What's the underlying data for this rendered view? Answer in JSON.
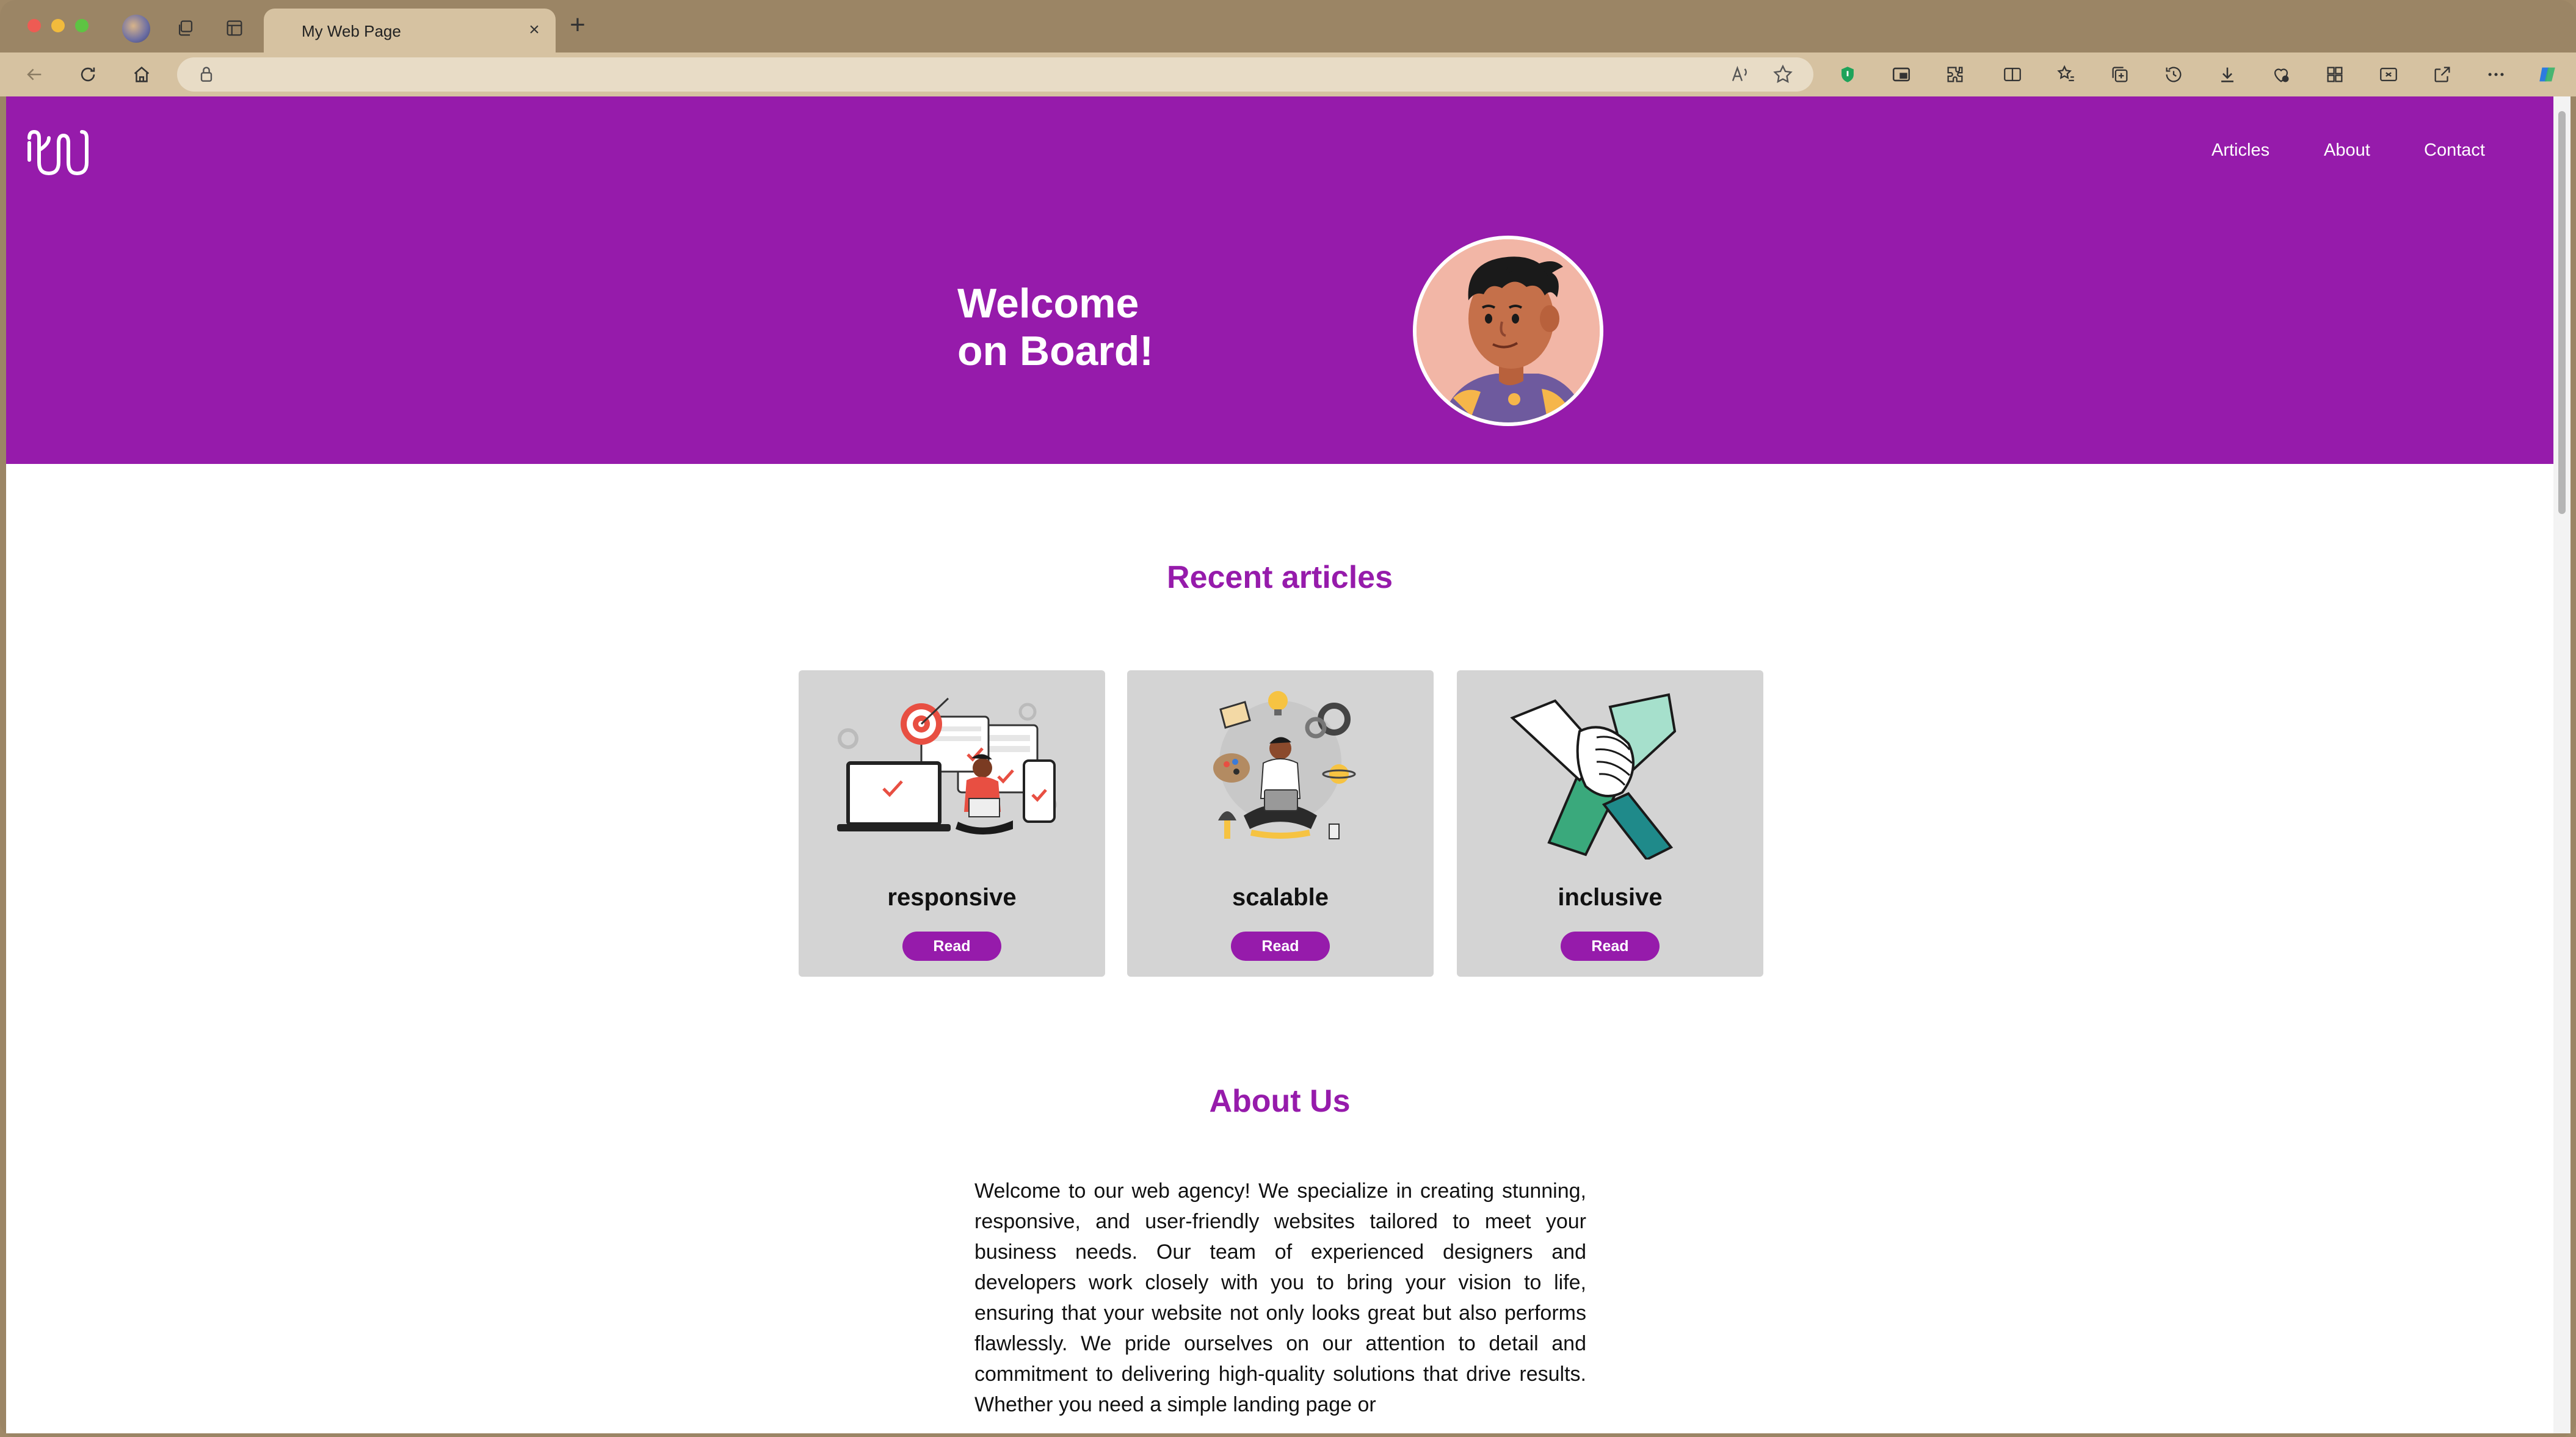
{
  "browser": {
    "tab_title": "My Web Page",
    "tab_close": "×",
    "new_tab": "+",
    "address_placeholder": "",
    "read_aloud_label": "A⁾"
  },
  "site": {
    "nav": {
      "articles": "Articles",
      "about": "About",
      "contact": "Contact"
    },
    "hero": {
      "line1": "Welcome",
      "line2": "on Board!"
    },
    "articles": {
      "title": "Recent articles",
      "cards": [
        {
          "title": "responsive",
          "button": "Read"
        },
        {
          "title": "scalable",
          "button": "Read"
        },
        {
          "title": "inclusive",
          "button": "Read"
        }
      ]
    },
    "about": {
      "title": "About Us",
      "text": "Welcome to our web agency! We specialize in creating stunning, responsive, and user-friendly websites tailored to meet your business needs. Our team of experienced designers and developers work closely with you to bring your vision to life, ensuring that your website not only looks great but also performs flawlessly. We pride ourselves on our attention to detail and commitment to delivering high-quality solutions that drive results. Whether you need a simple landing page or"
    }
  },
  "colors": {
    "brand": "#961bab",
    "card": "#d4d4d4",
    "chrome": "#d6c2a1"
  }
}
